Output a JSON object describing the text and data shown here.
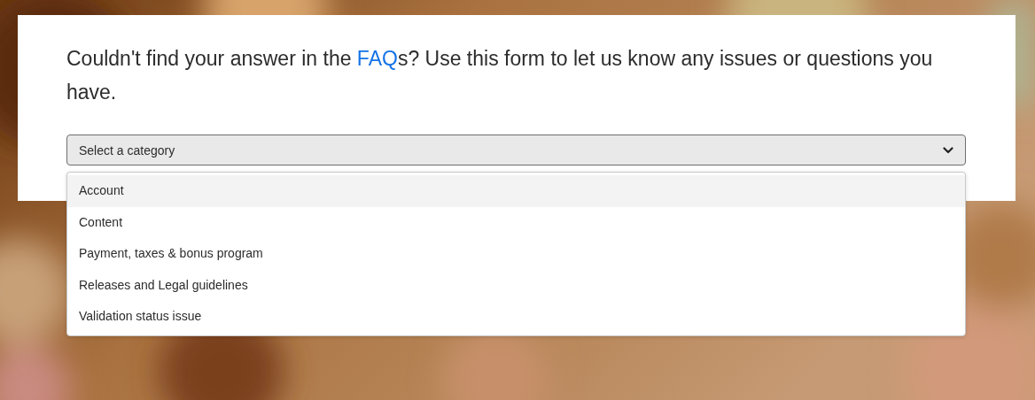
{
  "intro": {
    "before": "Couldn't find your answer in the ",
    "link": "FAQ",
    "after": "s? Use this form to let us know any issues or questions you have."
  },
  "select": {
    "placeholder": "Select a category",
    "expanded": true
  },
  "options": [
    {
      "label": "Account",
      "selected": true
    },
    {
      "label": "Content",
      "selected": false
    },
    {
      "label": "Payment, taxes & bonus program",
      "selected": false
    },
    {
      "label": "Releases and Legal guidelines",
      "selected": false
    },
    {
      "label": "Validation status issue",
      "selected": false
    }
  ]
}
